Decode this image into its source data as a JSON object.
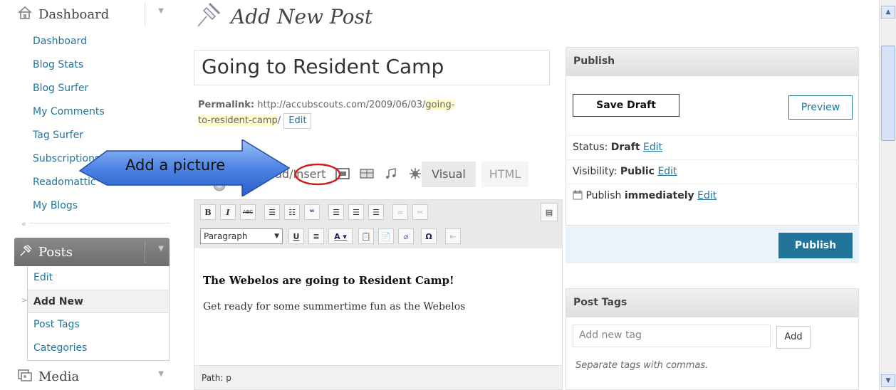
{
  "sidebar": {
    "dashboard_label": "Dashboard",
    "dashboard_items": [
      "Dashboard",
      "Blog Stats",
      "Blog Surfer",
      "My Comments",
      "Tag Surfer",
      "Subscriptions",
      "Readomattic",
      "My Blogs"
    ],
    "collapse_glyph": "«",
    "posts_label": "Posts",
    "posts_items": [
      "Edit",
      "Add New",
      "Post Tags",
      "Categories"
    ],
    "media_label": "Media"
  },
  "header": {
    "title": "Add New Post"
  },
  "post": {
    "title_value": "Going to Resident Camp",
    "permalink_label": "Permalink:",
    "permalink_base": "http://accubscouts.com/2009/06/03/",
    "permalink_slug_1": "going-",
    "permalink_slug_2": "to-resident-camp",
    "permalink_tail": "/",
    "permalink_edit": "Edit"
  },
  "upload": {
    "label": "Upload/Insert"
  },
  "editor": {
    "tab_visual": "Visual",
    "tab_html": "HTML",
    "format_select": "Paragraph",
    "heading": "The Webelos are going to Resident Camp!",
    "paragraph": "Get ready for some summertime fun as the Webelos",
    "path": "Path: p"
  },
  "publish": {
    "title": "Publish",
    "save_draft": "Save Draft",
    "preview": "Preview",
    "status_label": "Status:",
    "status_value": "Draft",
    "visibility_label": "Visibility:",
    "visibility_value": "Public",
    "schedule_label": "Publish",
    "schedule_value": "immediately",
    "edit_link": "Edit",
    "publish_button": "Publish"
  },
  "tags": {
    "title": "Post Tags",
    "placeholder": "Add new tag",
    "add_button": "Add",
    "hint": "Separate tags with commas."
  },
  "callout": {
    "text": "Add a picture"
  },
  "colors": {
    "link": "#21759b",
    "primary_button": "#21759b",
    "highlight": "#fffbcc",
    "callout_fill": "#3a6fd8",
    "circle": "#cc2222"
  }
}
